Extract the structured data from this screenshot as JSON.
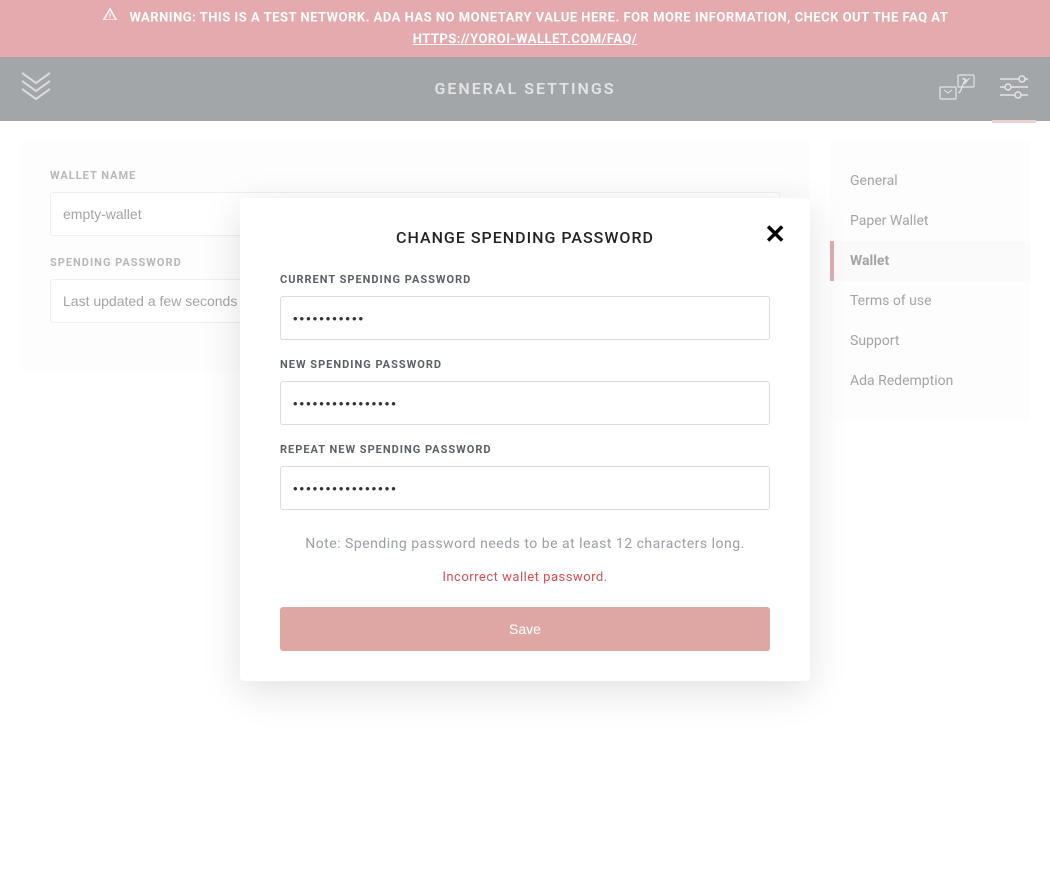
{
  "banner": {
    "text": "WARNING: THIS IS A TEST NETWORK. ADA HAS NO MONETARY VALUE HERE. FOR MORE INFORMATION, CHECK OUT THE FAQ AT ",
    "link": "HTTPS://YOROI-WALLET.COM/FAQ/"
  },
  "header": {
    "title": "GENERAL SETTINGS"
  },
  "settings": {
    "wallet_name_label": "WALLET NAME",
    "wallet_name_value": "empty-wallet",
    "spending_password_label": "SPENDING PASSWORD",
    "spending_password_value": "Last updated a few seconds ago"
  },
  "sidebar": {
    "items": [
      {
        "label": "General",
        "active": false
      },
      {
        "label": "Paper Wallet",
        "active": false
      },
      {
        "label": "Wallet",
        "active": true
      },
      {
        "label": "Terms of use",
        "active": false
      },
      {
        "label": "Support",
        "active": false
      },
      {
        "label": "Ada Redemption",
        "active": false
      }
    ]
  },
  "modal": {
    "title": "CHANGE SPENDING PASSWORD",
    "current_label": "CURRENT SPENDING PASSWORD",
    "current_value": "•••••••••••",
    "new_label": "NEW SPENDING PASSWORD",
    "new_value": "••••••••••••••••",
    "repeat_label": "REPEAT NEW SPENDING PASSWORD",
    "repeat_value": "••••••••••••••••",
    "note": "Note: Spending password needs to be at least 12 characters long.",
    "error": "Incorrect wallet password.",
    "save_label": "Save"
  },
  "colors": {
    "accent_red": "#c3434a",
    "header_bg": "#343a42",
    "error": "#d84f56",
    "save_btn": "#dfa7a4"
  }
}
